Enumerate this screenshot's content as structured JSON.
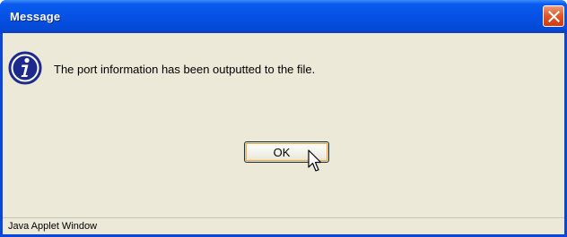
{
  "window": {
    "title": "Message",
    "close_icon": "close-icon"
  },
  "dialog": {
    "icon": "info-icon",
    "message": "The port information has been outputted to the file.",
    "ok_label": "OK"
  },
  "footer": {
    "applet_label": "Java Applet Window"
  },
  "colors": {
    "titlebar": "#0651e4",
    "client_background": "#ece9d8",
    "close_button": "#e05a2c",
    "info_icon": "#1c2a8c"
  }
}
